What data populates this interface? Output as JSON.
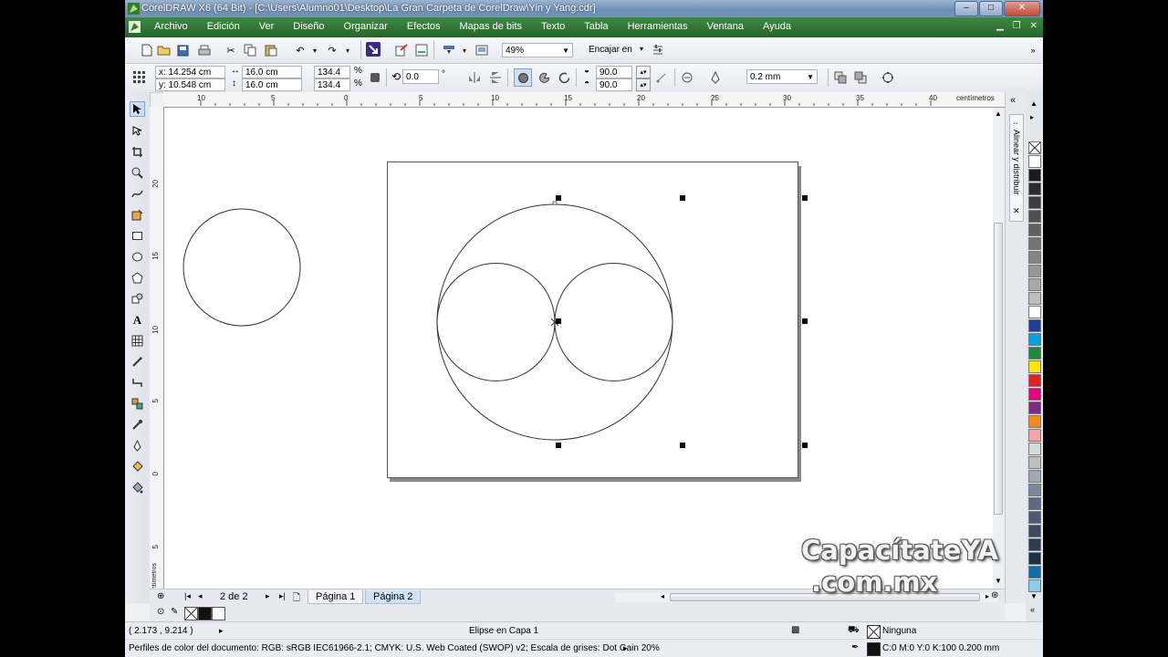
{
  "window": {
    "title": "CorelDRAW X6 (64 Bit) - [C:\\Users\\Alumno01\\Desktop\\La Gran Carpeta de CorelDraw\\Yin y Yang.cdr]",
    "controls": [
      "–",
      "□",
      "✕"
    ]
  },
  "menu": {
    "items": [
      "Archivo",
      "Edición",
      "Ver",
      "Diseño",
      "Organizar",
      "Efectos",
      "Mapas de bits",
      "Texto",
      "Tabla",
      "Herramientas",
      "Ventana",
      "Ayuda"
    ]
  },
  "standard_toolbar": {
    "zoom": "49%",
    "snap_label": "Encajar en"
  },
  "property_bar": {
    "x": "x: 14.254 cm",
    "y": "y: 10.548 cm",
    "width": "16.0 cm",
    "height": "16.0 cm",
    "scale_x": "134.4",
    "scale_y": "134.4",
    "percent": "%",
    "rotation": "0.0",
    "degree": "°",
    "angle_start": "90.0",
    "angle_end": "90.0",
    "outline_width": "0.2 mm"
  },
  "ruler": {
    "unit": "centímetros",
    "h_ticks": [
      "10",
      "5",
      "0",
      "5",
      "10",
      "15",
      "20",
      "25",
      "30",
      "35",
      "40"
    ],
    "v_ticks": [
      "20",
      "15",
      "10",
      "5",
      "0",
      "5"
    ],
    "v_unit": "centímetros"
  },
  "docker": {
    "title": "Alinear y distribuir"
  },
  "pages": {
    "counter": "2 de 2",
    "tabs": [
      "Página 1",
      "Página 2"
    ],
    "active": 1
  },
  "status": {
    "cursor_pos": "( 2.173 , 9.214 )",
    "selection": "Elipse en Capa 1",
    "fill": "Ninguna",
    "outline": "C:0 M:0 Y:0 K:100  0.200 mm",
    "color_profiles": "Perfiles de color del documento: RGB: sRGB IEC61966-2.1; CMYK: U.S. Web Coated (SWOP) v2; Escala de grises: Dot Gain 20%"
  },
  "palette_colors": [
    "#ffffff",
    "#1a1a1a",
    "#2b2b2b",
    "#3d3d3d",
    "#4f4f4f",
    "#616161",
    "#737373",
    "#858585",
    "#979797",
    "#a9a9a9",
    "#bdbdbd",
    "#ffffff",
    "#1f3f99",
    "#00a0e3",
    "#1b8a3c",
    "#ffe600",
    "#e31e24",
    "#e5007e",
    "#7d2a85",
    "#f18a1c",
    "#f4a6a6",
    "#d9d9d9",
    "#bfbfbf",
    "#9fa9b5",
    "#7b8899",
    "#5d6b7f",
    "#4b5a70",
    "#3c4a60",
    "#2d3b52",
    "#1e3146",
    "#0d6fa8",
    "#8ccde9"
  ],
  "watermark": {
    "line1": "CapacítateYA",
    "line2": ".com.mx"
  }
}
